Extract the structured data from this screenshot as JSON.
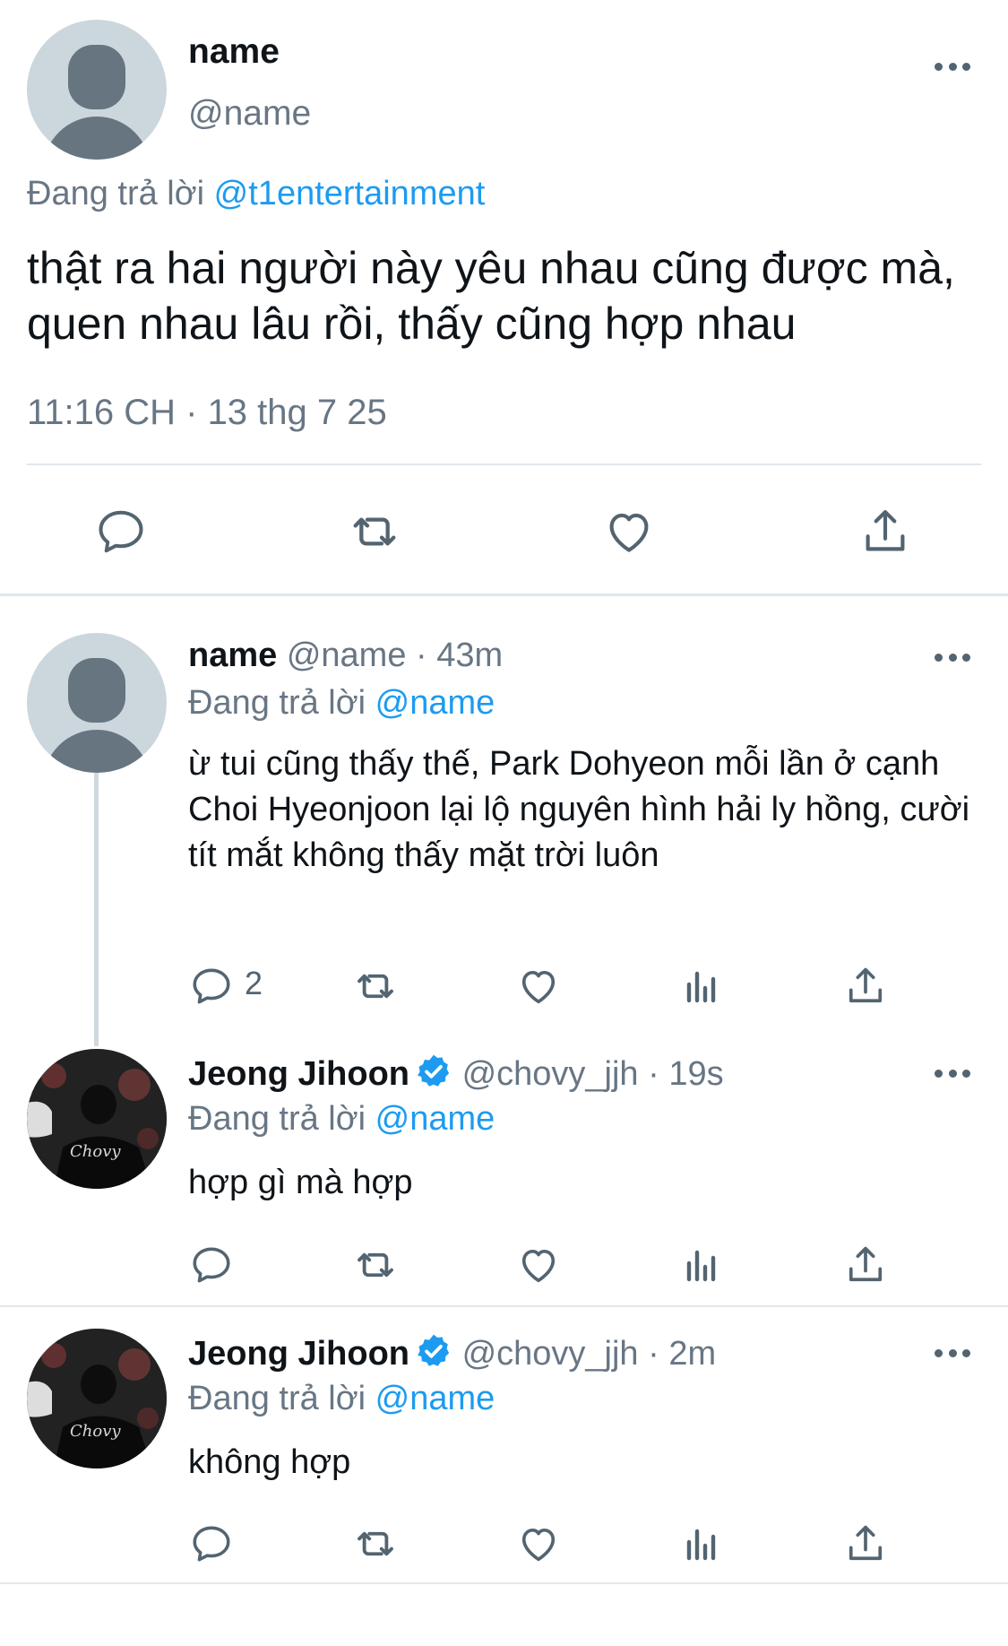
{
  "main_tweet": {
    "name": "name",
    "handle": "@name",
    "reply_prefix": "Đang trả lời",
    "reply_to": "@t1entertainment",
    "text": "thật ra hai người này yêu nhau cũng được mà, quen nhau lâu rồi, thấy cũng hợp nhau",
    "timestamp": "11:16 CH · 13 thg 7 25",
    "actions": [
      "reply-icon",
      "retweet-icon",
      "like-icon",
      "share-icon"
    ]
  },
  "replies": [
    {
      "name": "name",
      "handle": "@name",
      "time": "· 43m",
      "reply_prefix": "Đang trả lời",
      "reply_to": "@name",
      "text": "ừ tui cũng thấy thế, Park Dohyeon mỗi lần ở cạnh Choi Hyeonjoon lại lộ nguyên hình hải ly hồng, cười tít mắt không thấy mặt trời luôn",
      "reply_count": "2",
      "verified": false
    },
    {
      "name": "Jeong Jihoon",
      "handle": "@chovy_jjh",
      "time": "· 19s",
      "reply_prefix": "Đang trả lời",
      "reply_to": "@name",
      "text": "hợp gì mà hợp",
      "verified": true
    },
    {
      "name": "Jeong Jihoon",
      "handle": "@chovy_jjh",
      "time": "· 2m",
      "reply_prefix": "Đang trả lời",
      "reply_to": "@name",
      "text": "không hợp",
      "verified": true
    }
  ],
  "colors": {
    "link": "#1d9bf0",
    "secondary_text": "#687684",
    "icon": "#536471",
    "verified": "#1d9bf0",
    "divider": "#e1e8ed"
  }
}
